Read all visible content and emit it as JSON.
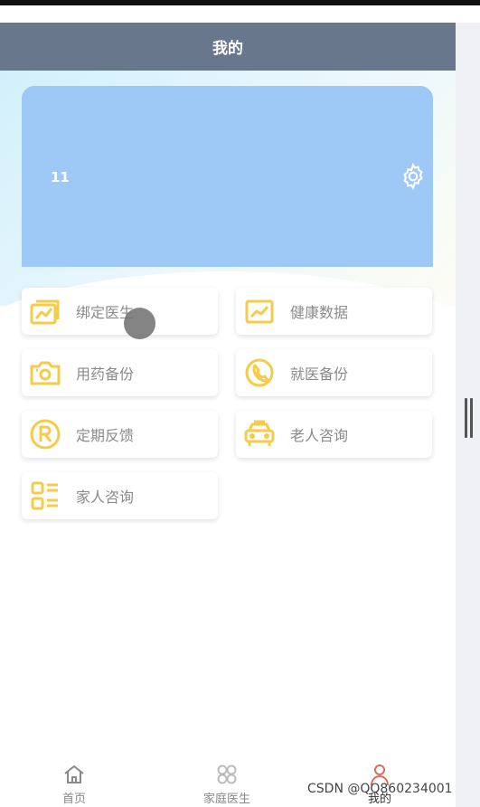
{
  "header": {
    "title": "我的"
  },
  "profile": {
    "name": "11"
  },
  "menu": [
    {
      "label": "绑定医生",
      "icon": "bind-doctor-icon"
    },
    {
      "label": "健康数据",
      "icon": "health-chart-icon"
    },
    {
      "label": "用药备份",
      "icon": "camera-icon"
    },
    {
      "label": "就医备份",
      "icon": "phone-icon"
    },
    {
      "label": "定期反馈",
      "icon": "registered-icon"
    },
    {
      "label": "老人咨询",
      "icon": "car-icon"
    },
    {
      "label": "家人咨询",
      "icon": "list-icon"
    }
  ],
  "tabbar": [
    {
      "label": "首页",
      "icon": "home-icon"
    },
    {
      "label": "家庭医生",
      "icon": "clover-icon"
    },
    {
      "label": "我的",
      "icon": "person-icon",
      "active": true
    }
  ],
  "watermark": "CSDN @QQ860234001",
  "colors": {
    "header": "#69778c",
    "card": "#9ec8f5",
    "icon": "#f5cb4a",
    "tab_active": "#e36b5e"
  }
}
